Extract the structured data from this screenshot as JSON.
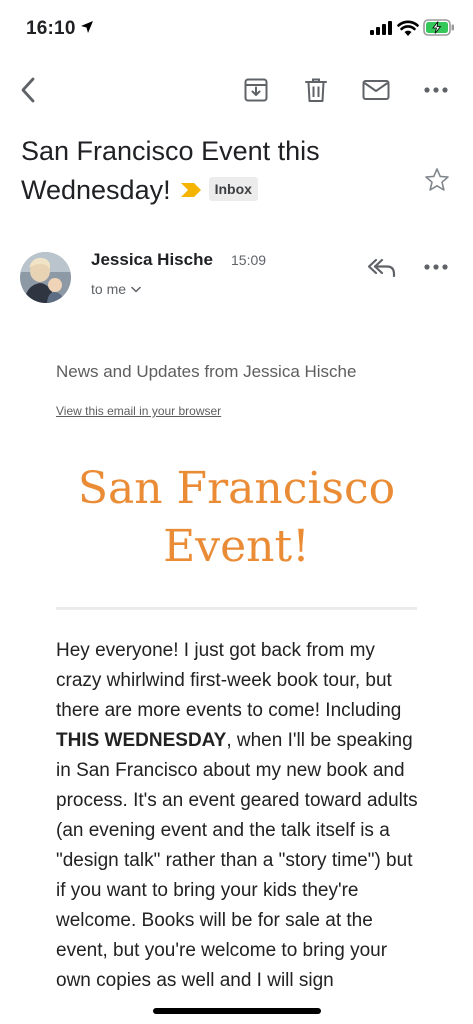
{
  "status_bar": {
    "time": "16:10",
    "icons": [
      "location-arrow-icon",
      "signal-icon",
      "wifi-icon",
      "battery-charging-icon"
    ],
    "battery_color": "#34c759"
  },
  "toolbar": {
    "icons": [
      "back-arrow-icon",
      "archive-icon",
      "trash-icon",
      "mail-icon",
      "more-horizontal-icon"
    ]
  },
  "email": {
    "subject": "San Francisco Event this Wednesday!",
    "label": "Inbox",
    "importance_color": "#f4b400",
    "sender": {
      "name": "Jessica Hische",
      "time": "15:09",
      "recipient": "to me"
    },
    "body": {
      "preheader": "News and Updates from Jessica Hische",
      "view_link": "View this email in your browser",
      "headline": "San Francisco Event!",
      "headline_color": "#ea8c35",
      "paragraph_intro": "Hey everyone! I just got back from my crazy whirlwind first-week book tour, but there are more events to come! Including ",
      "paragraph_bold": "THIS WEDNESDAY",
      "paragraph_rest": ", when I'll be speaking in San Francisco about my new book and process. It's an event geared toward adults (an evening event and the talk itself is a \"design talk\" rather than a \"story time\") but if you want to bring your kids they're welcome. Books will be for sale at the event, but you're welcome to bring your own copies as well and I will sign"
    }
  }
}
